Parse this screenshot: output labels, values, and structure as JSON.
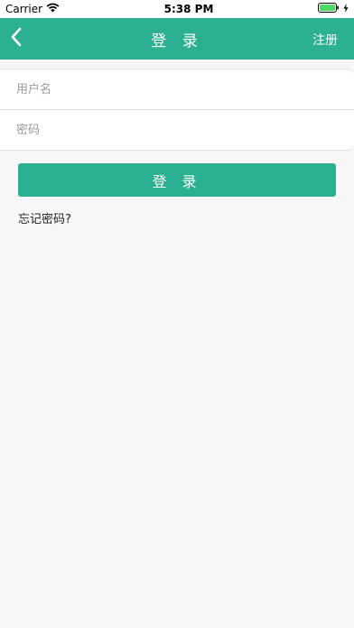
{
  "status_bar": {
    "carrier": "Carrier",
    "time": "5:38 PM",
    "icons": [
      "wifi-icon",
      "battery-icon",
      "charging-bolt-icon"
    ],
    "battery_color": "#4cd964"
  },
  "nav": {
    "title": "登 录",
    "register_label": "注册",
    "back_icon": "chevron-left-icon",
    "background_color": "#2bb091"
  },
  "form": {
    "username_placeholder": "用户名",
    "password_placeholder": "密码"
  },
  "login_button": {
    "label": "登 录",
    "color": "#2bb091"
  },
  "forgot_password": "忘记密码?"
}
